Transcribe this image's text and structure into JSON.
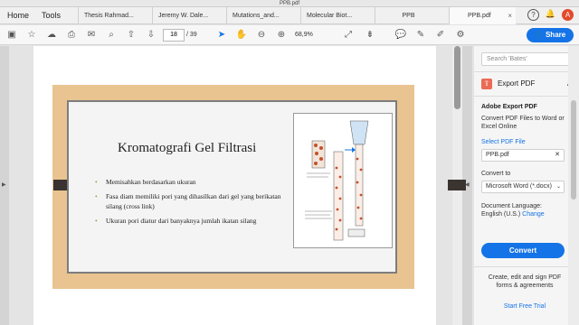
{
  "window": {
    "title": "PPB.pdf"
  },
  "nav": {
    "home": "Home",
    "tools": "Tools"
  },
  "tabs": [
    {
      "label": "Thesis Rahmad..."
    },
    {
      "label": "Jeremy W. Dale..."
    },
    {
      "label": "Mutations_and..."
    },
    {
      "label": "Molecular Biot..."
    },
    {
      "label": "PPB"
    },
    {
      "label": "PPB.pdf"
    }
  ],
  "tab_close": "×",
  "header_icons": {
    "help": "?",
    "bell": "🔔",
    "user": "A"
  },
  "toolbar": {
    "page_current": "18",
    "page_total": "/ 39",
    "zoom": "68,9%",
    "share_label": "Share"
  },
  "slide": {
    "title": "Kromatografi Gel Filtrasi",
    "bullets": [
      "Memisahkan berdasarkan ukuran",
      "Fasa diam memiliki pori yang dihasilkan dari gel yang berikatan silang (cross link)",
      "Ukuran pori diatur dari banyaknya jumlah ikatan silang"
    ]
  },
  "panel": {
    "search_placeholder": "Search 'Bates'",
    "export_header": "Export PDF",
    "section_title": "Adobe Export PDF",
    "desc": "Convert PDF Files to Word or Excel Online",
    "select_label": "Select PDF File",
    "file_name": "PPB.pdf",
    "convert_to_label": "Convert to",
    "convert_to_value": "Microsoft Word (*.docx)",
    "doc_lang_label": "Document Language:",
    "doc_lang_value": "English (U.S.)",
    "change_link": "Change",
    "convert_button": "Convert",
    "promo": "Create, edit and sign PDF forms & agreements",
    "trial": "Start Free Trial"
  },
  "colors": {
    "accent": "#1473e6",
    "slide_frame": "#e9c490",
    "export_icon": "#ec6b55"
  }
}
